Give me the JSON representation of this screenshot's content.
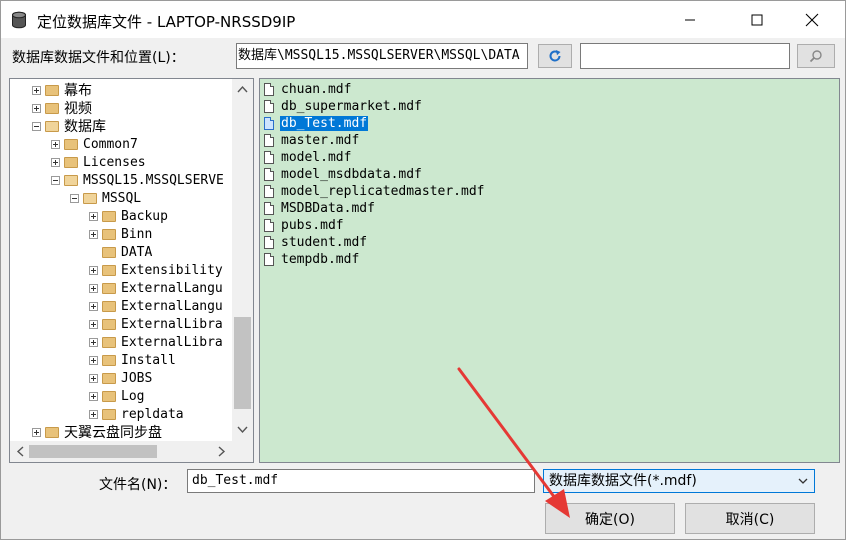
{
  "window": {
    "title": "定位数据库文件 - LAPTOP-NRSSD9IP"
  },
  "location": {
    "label": "数据库数据文件和位置(L)：",
    "path_value": "数据库\\MSSQL15.MSSQLSERVER\\MSSQL\\DATA",
    "search_value": ""
  },
  "tree": [
    {
      "label": "幕布",
      "cn": true
    },
    {
      "label": "视频",
      "cn": true
    },
    {
      "label": "数据库",
      "cn": true
    },
    {
      "label": "Common7",
      "cn": false
    },
    {
      "label": "Licenses",
      "cn": false
    },
    {
      "label": "MSSQL15.MSSQLSERVE",
      "cn": false
    },
    {
      "label": "MSSQL",
      "cn": false
    },
    {
      "label": "Backup",
      "cn": false
    },
    {
      "label": "Binn",
      "cn": false
    },
    {
      "label": "DATA",
      "cn": false
    },
    {
      "label": "Extensibility",
      "cn": false
    },
    {
      "label": "ExternalLangu",
      "cn": false
    },
    {
      "label": "ExternalLangu",
      "cn": false
    },
    {
      "label": "ExternalLibra",
      "cn": false
    },
    {
      "label": "ExternalLibra",
      "cn": false
    },
    {
      "label": "Install",
      "cn": false
    },
    {
      "label": "JOBS",
      "cn": false
    },
    {
      "label": "Log",
      "cn": false
    },
    {
      "label": "repldata",
      "cn": false
    },
    {
      "label": "天翼云盘同步盘",
      "cn": true
    }
  ],
  "files": [
    "chuan.mdf",
    "db_supermarket.mdf",
    "db_Test.mdf",
    "master.mdf",
    "model.mdf",
    "model_msdbdata.mdf",
    "model_replicatedmaster.mdf",
    "MSDBData.mdf",
    "pubs.mdf",
    "student.mdf",
    "tempdb.mdf"
  ],
  "selected_file": "db_Test.mdf",
  "filename": {
    "label": "文件名(N)：",
    "value": "db_Test.mdf"
  },
  "filetype": {
    "value": "数据库数据文件(*.mdf)"
  },
  "buttons": {
    "ok": "确定(O)",
    "cancel": "取消(C)"
  },
  "colors": {
    "file_list_bg": "#cce8cf",
    "selection": "#0078d7",
    "annotation_arrow": "#e53935"
  }
}
